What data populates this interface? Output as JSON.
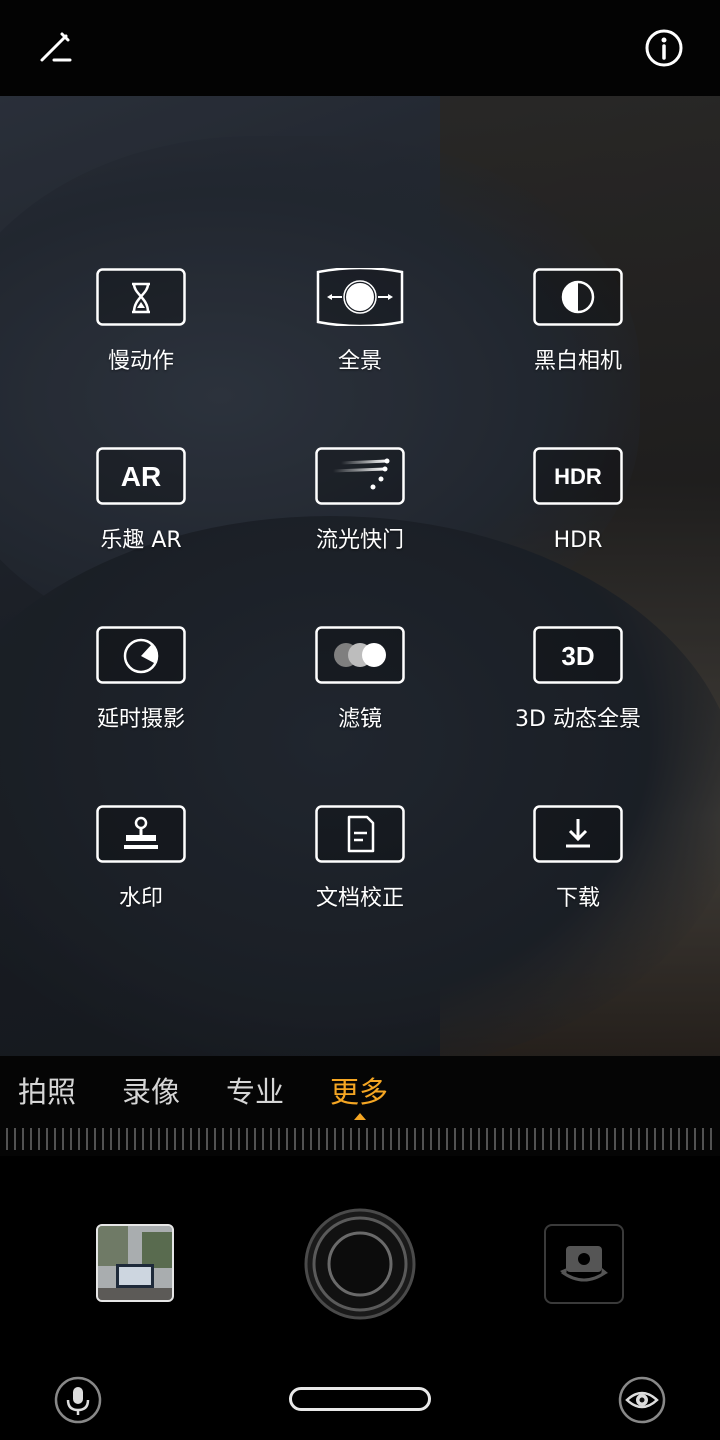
{
  "topbar": {
    "edit_icon": "pencil-edit-icon",
    "info_icon": "info-icon"
  },
  "modes": [
    {
      "label": "慢动作",
      "icon": "hourglass-icon"
    },
    {
      "label": "全景",
      "icon": "panorama-icon"
    },
    {
      "label": "黑白相机",
      "icon": "half-circle-icon"
    },
    {
      "label": "乐趣 AR",
      "icon": "ar-icon",
      "icon_text": "AR"
    },
    {
      "label": "流光快门",
      "icon": "light-trail-icon"
    },
    {
      "label": "HDR",
      "icon": "hdr-icon",
      "icon_text": "HDR"
    },
    {
      "label": "延时摄影",
      "icon": "timelapse-icon"
    },
    {
      "label": "滤镜",
      "icon": "filter-circles-icon"
    },
    {
      "label": "3D 动态全景",
      "icon": "3d-icon",
      "icon_text": "3D"
    },
    {
      "label": "水印",
      "icon": "stamp-icon"
    },
    {
      "label": "文档校正",
      "icon": "document-icon"
    },
    {
      "label": "下载",
      "icon": "download-icon"
    }
  ],
  "tabs": [
    {
      "label": "拍照",
      "active": false
    },
    {
      "label": "录像",
      "active": false
    },
    {
      "label": "专业",
      "active": false
    },
    {
      "label": "更多",
      "active": true
    }
  ],
  "controls": {
    "gallery_thumbnail": "gallery-thumbnail",
    "shutter": "shutter-button",
    "switch_camera_icon": "switch-camera-icon",
    "mic_icon": "microphone-icon",
    "eye_icon": "eye-icon"
  },
  "colors": {
    "accent": "#f5a623",
    "text": "#ffffff",
    "tab_inactive": "#d6d6d6"
  }
}
